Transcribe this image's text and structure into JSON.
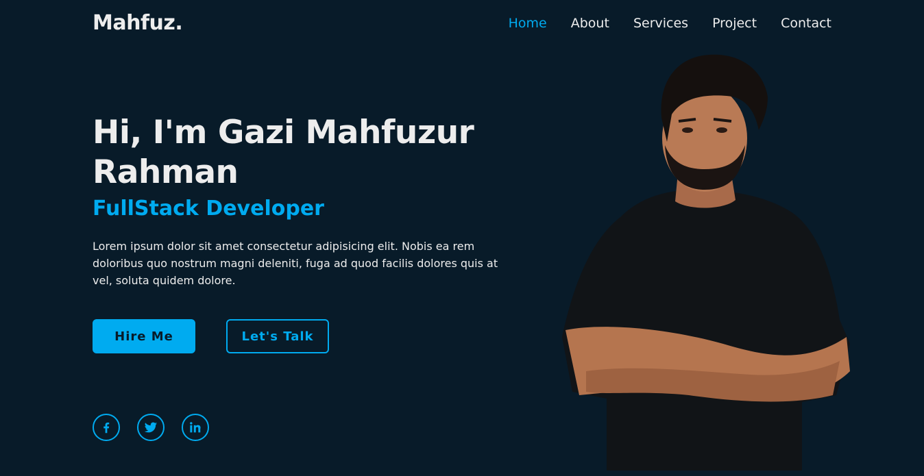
{
  "brand": {
    "logo": "Mahfuz."
  },
  "nav": {
    "items": [
      {
        "label": "Home",
        "active": true
      },
      {
        "label": "About",
        "active": false
      },
      {
        "label": "Services",
        "active": false
      },
      {
        "label": "Project",
        "active": false
      },
      {
        "label": "Contact",
        "active": false
      }
    ]
  },
  "hero": {
    "title_line1": "Hi, I'm Gazi Mahfuzur",
    "title_line2": "Rahman",
    "role": "FullStack Developer",
    "description": "Lorem ipsum dolor sit amet consectetur adipisicing elit. Nobis ea rem doloribus quo nostrum magni deleniti, fuga ad quod facilis dolores quis at vel, soluta quidem dolore.",
    "primary_button": "Hire Me",
    "secondary_button": "Let's Talk"
  },
  "social": {
    "icons": [
      "facebook-icon",
      "twitter-icon",
      "linkedin-icon"
    ]
  },
  "colors": {
    "background": "#081b29",
    "accent": "#00abf0",
    "text": "#ededed"
  }
}
